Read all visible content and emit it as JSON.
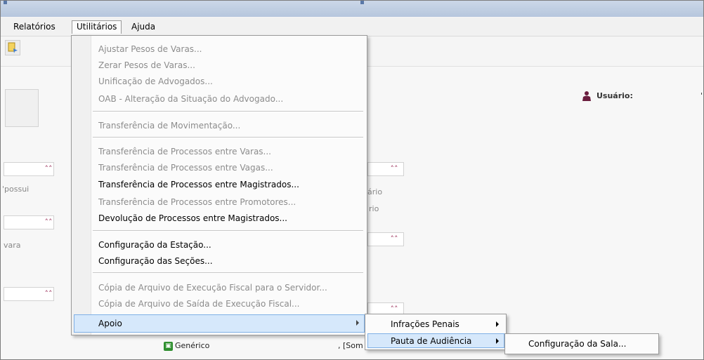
{
  "menubar": {
    "items": [
      {
        "label": "Relatórios"
      },
      {
        "label": "Utilitários"
      },
      {
        "label": "Ajuda"
      }
    ]
  },
  "header": {
    "user_label": "Usuário:",
    "user_value": "'l"
  },
  "background": {
    "side_texts": [
      "'possui",
      "vara",
      "ário",
      "rio"
    ],
    "bottom_item": "Genérico",
    "bottom_som": ", [Som"
  },
  "utilitarios_menu": {
    "items": [
      {
        "label": "Ajustar Pesos de Varas...",
        "enabled": false
      },
      {
        "label": "Zerar Pesos de Varas...",
        "enabled": false
      },
      {
        "label": "Unificação de Advogados...",
        "enabled": false
      },
      {
        "label": "OAB - Alteração da Situação do Advogado...",
        "enabled": false
      },
      {
        "label": "Transferência de Movimentação...",
        "enabled": false
      },
      {
        "label": "Transferência de Processos entre Varas...",
        "enabled": false
      },
      {
        "label": "Transferência de Processos entre Vagas...",
        "enabled": false
      },
      {
        "label": "Transferência de Processos entre Magistrados...",
        "enabled": true
      },
      {
        "label": "Transferência de Processos entre Promotores...",
        "enabled": false
      },
      {
        "label": "Devolução de Processos entre Magistrados...",
        "enabled": true
      },
      {
        "label": "Configuração da Estação...",
        "enabled": true
      },
      {
        "label": "Configuração das Seções...",
        "enabled": true
      },
      {
        "label": "Cópia de Arquivo de Execução Fiscal para o Servidor...",
        "enabled": false
      },
      {
        "label": "Cópia de Arquivo de Saída de Execução Fiscal...",
        "enabled": false
      }
    ],
    "apoio": "Apoio"
  },
  "apoio_menu": {
    "items": [
      {
        "label": "Infrações Penais"
      },
      {
        "label": "Pauta de Audiência"
      }
    ]
  },
  "pauta_menu": {
    "items": [
      {
        "label": "Configuração da Sala..."
      }
    ]
  },
  "colors": {
    "highlight": "#d6e8fb",
    "highlight_border": "#7fb0e6",
    "disabled_text": "#8c8c8c",
    "collapse_icon": "#9b2f5a"
  }
}
